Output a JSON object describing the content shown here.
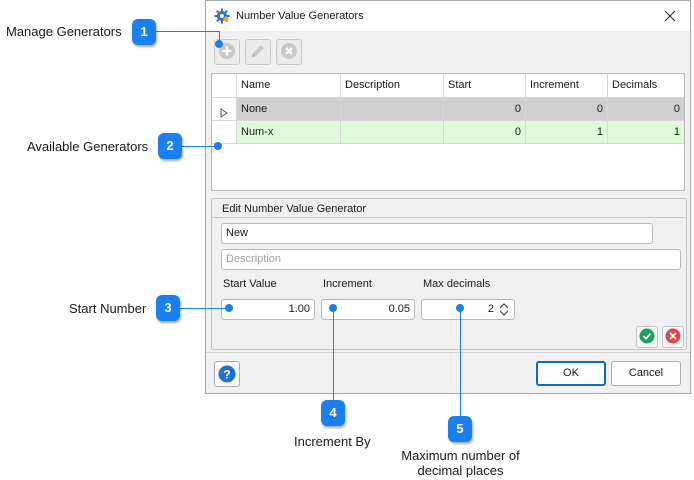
{
  "dialog": {
    "title": "Number Value Generators",
    "icon": "gear-icon",
    "toolbar": [
      {
        "name": "add",
        "icon": "plus-circle-icon"
      },
      {
        "name": "edit",
        "icon": "pencil-icon"
      },
      {
        "name": "delete",
        "icon": "x-circle-icon"
      }
    ],
    "grid": {
      "columns": [
        "Name",
        "Description",
        "Start",
        "Increment",
        "Decimals"
      ],
      "rows": [
        {
          "name": "None",
          "description": "",
          "start": "0",
          "increment": "0",
          "decimals": "0"
        },
        {
          "name": "Num-x",
          "description": "",
          "start": "0",
          "increment": "1",
          "decimals": "1"
        }
      ]
    },
    "edit": {
      "title": "Edit Number Value Generator",
      "name_value": "New",
      "description_placeholder": "Description",
      "start_label": "Start Value",
      "start_value": "1.00",
      "increment_label": "Increment",
      "increment_value": "0.05",
      "decimals_label": "Max decimals",
      "decimals_value": "2"
    },
    "ok_label": "OK",
    "cancel_label": "Cancel"
  },
  "callouts": [
    {
      "number": "1",
      "label": "Manage Generators"
    },
    {
      "number": "2",
      "label": "Available Generators"
    },
    {
      "number": "3",
      "label": "Start Number"
    },
    {
      "number": "4",
      "label": "Increment By"
    },
    {
      "number": "5",
      "label_line1": "Maximum number of",
      "label_line2": "decimal places"
    }
  ],
  "colors": {
    "callout": "#1a7ff0",
    "selected_row": "#cfcfcf",
    "highlight_row": "#dffad9",
    "accept": "#1aa260",
    "reject": "#e04848"
  }
}
